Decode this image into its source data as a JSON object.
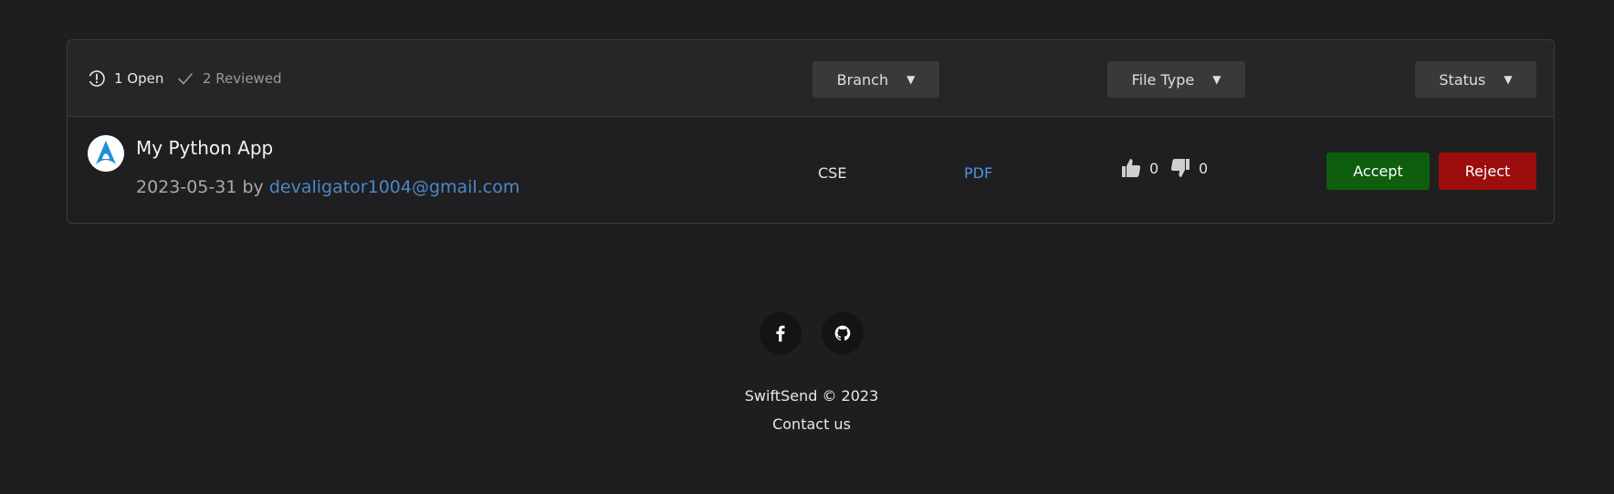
{
  "header": {
    "open_tab": "1 Open",
    "reviewed_tab": "2 Reviewed"
  },
  "filters": {
    "branch": "Branch",
    "file_type": "File Type",
    "status": "Status",
    "caret": "▼"
  },
  "submissions": [
    {
      "title": "My Python App",
      "date": "2023-05-31",
      "by": "by",
      "email": "devaligator1004@gmail.com",
      "branch": "CSE",
      "file_type": "PDF",
      "upvotes": "0",
      "downvotes": "0",
      "accept_label": "Accept",
      "reject_label": "Reject"
    }
  ],
  "footer": {
    "copyright": "SwiftSend © 2023",
    "contact": "Contact us",
    "social_icons": [
      "facebook-icon",
      "github-icon"
    ]
  },
  "colors": {
    "background": "#1e1e20",
    "accept": "#0d5e0d",
    "reject": "#9c0d0d",
    "link": "#4f86c6",
    "file_link": "#4f93e0"
  }
}
